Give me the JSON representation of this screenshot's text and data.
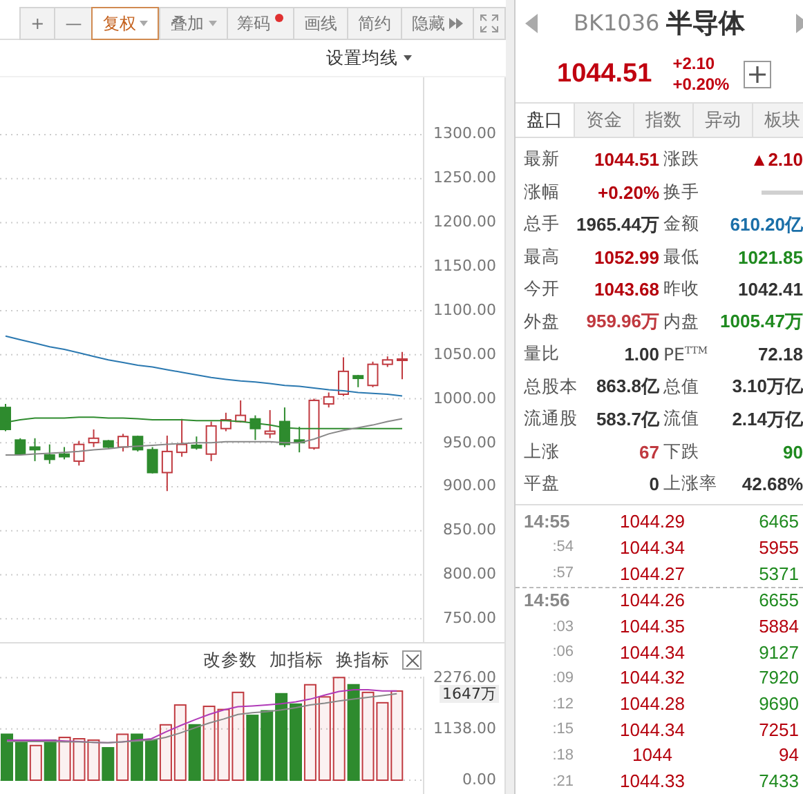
{
  "toolbar": {
    "buttons": [
      {
        "label": "+",
        "kind": "plain",
        "selected": false
      },
      {
        "label": "—",
        "kind": "plain",
        "selected": false
      },
      {
        "label": "复权",
        "kind": "dropdown",
        "selected": true
      },
      {
        "label": "叠加",
        "kind": "dropdown",
        "selected": false
      },
      {
        "label": "筹码",
        "kind": "dot",
        "selected": false
      },
      {
        "label": "画线",
        "kind": "plain",
        "selected": false
      },
      {
        "label": "简约",
        "kind": "plain",
        "selected": false
      },
      {
        "label": "隐藏",
        "kind": "more",
        "selected": false
      }
    ]
  },
  "ma_setting": "设置均线",
  "price_chart": {
    "chart_data": {
      "type": "candlestick",
      "grid": true,
      "ylim": [
        725,
        1365
      ],
      "yticks": [
        {
          "value": 1300,
          "label": "1300.00"
        },
        {
          "value": 1250,
          "label": "1250.00"
        },
        {
          "value": 1200,
          "label": "1200.00"
        },
        {
          "value": 1150,
          "label": "1150.00"
        },
        {
          "value": 1100,
          "label": "1100.00"
        },
        {
          "value": 1050,
          "label": "1050.00"
        },
        {
          "value": 1000,
          "label": "1000.00"
        },
        {
          "value": 950,
          "label": "950.00"
        },
        {
          "value": 900,
          "label": "900.00"
        },
        {
          "value": 850,
          "label": "850.00"
        },
        {
          "value": 800,
          "label": "800.00"
        },
        {
          "value": 750,
          "label": "750.00"
        }
      ],
      "ohlc": [
        [
          990,
          994,
          963,
          965
        ],
        [
          953,
          955,
          936,
          937
        ],
        [
          945,
          955,
          929,
          942
        ],
        [
          936,
          948,
          926,
          931
        ],
        [
          937,
          945,
          931,
          934
        ],
        [
          929,
          952,
          924,
          948
        ],
        [
          950,
          965,
          945,
          955
        ],
        [
          952,
          953,
          944,
          945
        ],
        [
          945,
          960,
          940,
          957
        ],
        [
          957,
          958,
          940,
          942
        ],
        [
          942,
          945,
          915,
          916
        ],
        [
          916,
          958,
          895,
          940
        ],
        [
          939,
          977,
          934,
          948
        ],
        [
          947,
          957,
          942,
          944
        ],
        [
          937,
          974,
          929,
          969
        ],
        [
          966,
          984,
          963,
          976
        ],
        [
          974,
          998,
          973,
          981
        ],
        [
          977,
          981,
          953,
          966
        ],
        [
          960,
          987,
          955,
          963
        ],
        [
          974,
          990,
          945,
          948
        ],
        [
          953,
          968,
          939,
          950
        ],
        [
          944,
          1000,
          942,
          998
        ],
        [
          994,
          1007,
          990,
          1002
        ],
        [
          1005,
          1047,
          1003,
          1031
        ],
        [
          1026,
          1027,
          1013,
          1023
        ],
        [
          1015,
          1042,
          1013,
          1039
        ],
        [
          1039,
          1048,
          1036,
          1044
        ],
        [
          1044,
          1053,
          1022,
          1045
        ]
      ],
      "series": [
        {
          "type": "line",
          "color": "#2a78b0",
          "values": [
            1071,
            1067,
            1063,
            1059,
            1056,
            1052,
            1048,
            1044,
            1041,
            1038,
            1036,
            1033,
            1030,
            1027,
            1024,
            1022,
            1020,
            1019,
            1017,
            1015,
            1014,
            1012,
            1010,
            1009,
            1007,
            1006,
            1005,
            1003
          ]
        },
        {
          "type": "line",
          "color": "#2e8b2e",
          "values": [
            973,
            976,
            978,
            978,
            978,
            979,
            979,
            978,
            978,
            977,
            976,
            976,
            976,
            975,
            975,
            975,
            974,
            972,
            970,
            967,
            966,
            966,
            966,
            966,
            966,
            966,
            966,
            966
          ]
        },
        {
          "type": "line",
          "color": "#888888",
          "values": [
            936,
            936,
            937,
            938,
            939,
            940,
            942,
            943,
            945,
            946,
            947,
            948,
            949,
            950,
            950,
            951,
            951,
            951,
            951,
            950,
            950,
            954,
            960,
            964,
            967,
            970,
            974,
            977
          ]
        }
      ]
    }
  },
  "volume_panel": {
    "actions": [
      "改参数",
      "加指标",
      "换指标"
    ],
    "current_label": "1647万",
    "chart_data": {
      "type": "bar",
      "grid": true,
      "ylim": [
        0,
        2300
      ],
      "yticks": [
        {
          "value": 2276,
          "label": "2276.00"
        },
        {
          "value": 1138,
          "label": "1138.00"
        },
        {
          "value": 0,
          "label": "0.00"
        }
      ],
      "series": [
        {
          "color": "#c0393f",
          "values": [
            null,
            null,
            770,
            null,
            950,
            920,
            890,
            null,
            1020,
            null,
            null,
            1230,
            1670,
            null,
            1640,
            1570,
            1950,
            null,
            null,
            null,
            null,
            2120,
            1850,
            2280,
            null,
            1950,
            1720,
            1980
          ]
        },
        {
          "color": "#2e8b2e",
          "values": [
            1020,
            870,
            null,
            890,
            null,
            null,
            null,
            720,
            null,
            1020,
            890,
            null,
            null,
            1230,
            null,
            null,
            null,
            1440,
            1540,
            1920,
            1690,
            null,
            null,
            null,
            2120,
            null,
            null,
            null
          ]
        },
        {
          "type": "line",
          "color": "#b03ab8",
          "values": [
            890,
            890,
            890,
            890,
            870,
            860,
            840,
            830,
            850,
            890,
            920,
            1070,
            1210,
            1340,
            1460,
            1560,
            1630,
            1650,
            1670,
            1700,
            1740,
            1800,
            1890,
            1970,
            2010,
            2010,
            1980,
            1980
          ]
        },
        {
          "type": "line",
          "color": "#888888",
          "values": [
            860,
            860,
            860,
            860,
            850,
            850,
            840,
            830,
            850,
            870,
            890,
            950,
            1050,
            1160,
            1270,
            1360,
            1460,
            1500,
            1520,
            1560,
            1610,
            1670,
            1710,
            1760,
            1800,
            1840,
            1880,
            1920
          ]
        }
      ]
    }
  },
  "quote": {
    "code": "BK1036",
    "name": "半导体",
    "price": "1044.51",
    "change": "+2.10",
    "change_pct": "+0.20%"
  },
  "tabs": [
    {
      "label": "盘口",
      "selected": true
    },
    {
      "label": "资金",
      "selected": false
    },
    {
      "label": "指数",
      "selected": false
    },
    {
      "label": "异动",
      "selected": false
    },
    {
      "label": "板块",
      "selected": false
    }
  ],
  "stats": [
    {
      "label": "最新",
      "value": "1044.51",
      "color": "#b5000c"
    },
    {
      "label": "涨跌",
      "value": "▲2.10",
      "color": "#b5000c"
    },
    {
      "label": "涨幅",
      "value": "+0.20%",
      "color": "#b5000c"
    },
    {
      "label": "换手"
    },
    {
      "label": "总手",
      "value": "1965.44万",
      "color": "#333333"
    },
    {
      "label": "金额",
      "value": "610.20亿",
      "color": "#1b6fa8"
    },
    {
      "label": "最高",
      "value": "1052.99",
      "color": "#b5000c"
    },
    {
      "label": "最低",
      "value": "1021.85",
      "color": "#1f8a1f"
    },
    {
      "label": "今开",
      "value": "1043.68",
      "color": "#b5000c"
    },
    {
      "label": "昨收",
      "value": "1042.41",
      "color": "#333333"
    },
    {
      "label": "外盘",
      "value": "959.96万",
      "color": "#c0393f"
    },
    {
      "label": "内盘",
      "value": "1005.47万",
      "color": "#1f8a1f"
    },
    {
      "label": "量比",
      "value": "1.00",
      "color": "#333333"
    },
    {
      "label": "PE$^{TTM}$",
      "value": "72.18",
      "color": "#333333"
    },
    {
      "label": "总股本",
      "value": "863.8亿",
      "color": "#333333"
    },
    {
      "label": "总值",
      "value": "3.10万亿",
      "color": "#333333"
    },
    {
      "label": "流通股",
      "value": "583.7亿",
      "color": "#333333"
    },
    {
      "label": "流值",
      "value": "2.14万亿",
      "color": "#333333"
    },
    {
      "label": "上涨",
      "value": "67",
      "color": "#c0393f"
    },
    {
      "label": "下跌",
      "value": "90",
      "color": "#1f8a1f"
    },
    {
      "label": "平盘",
      "value": "0",
      "color": "#333333"
    },
    {
      "label": "上涨率",
      "value": "42.68%",
      "color": "#333333"
    }
  ],
  "ticks": [
    {
      "time": "14:55",
      "price": "1044.29",
      "volume": "6465",
      "color": "#1f8a1f",
      "kind": "minute"
    },
    {
      "time": ":54",
      "price": "1044.34",
      "volume": "5955",
      "color": "#b5000c",
      "kind": "second"
    },
    {
      "time": ":57",
      "price": "1044.27",
      "volume": "5371",
      "color": "#1f8a1f",
      "kind": "second"
    },
    {
      "time": "14:56",
      "price": "1044.26",
      "volume": "6655",
      "color": "#1f8a1f",
      "kind": "minute"
    },
    {
      "time": ":03",
      "price": "1044.35",
      "volume": "5884",
      "color": "#b5000c",
      "kind": "second"
    },
    {
      "time": ":06",
      "price": "1044.34",
      "volume": "9127",
      "color": "#1f8a1f",
      "kind": "second"
    },
    {
      "time": ":09",
      "price": "1044.32",
      "volume": "7920",
      "color": "#1f8a1f",
      "kind": "second"
    },
    {
      "time": ":12",
      "price": "1044.28",
      "volume": "9690",
      "color": "#1f8a1f",
      "kind": "second"
    },
    {
      "time": ":15",
      "price": "1044.34",
      "volume": "7251",
      "color": "#b5000c",
      "kind": "second"
    },
    {
      "time": ":18",
      "price": "1044",
      "volume": "94",
      "color": "#b5000c",
      "kind": "second"
    },
    {
      "time": ":21",
      "price": "1044.33",
      "volume": "7433",
      "color": "#1f8a1f",
      "kind": "second"
    }
  ]
}
